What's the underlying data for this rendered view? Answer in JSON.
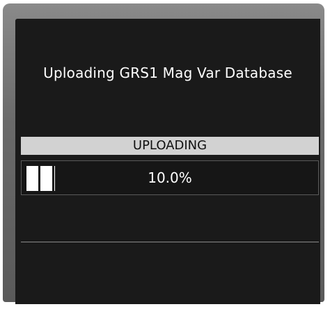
{
  "dialog": {
    "title": "Uploading GRS1 Mag Var Database",
    "status": "UPLOADING",
    "progress_text": "10.0%",
    "progress_fraction": 0.1
  },
  "colors": {
    "screen_background": "#1a1a1a",
    "status_bar_background": "#d2d2d2",
    "progress_fill": "#ffffff",
    "text": "#ffffff"
  }
}
